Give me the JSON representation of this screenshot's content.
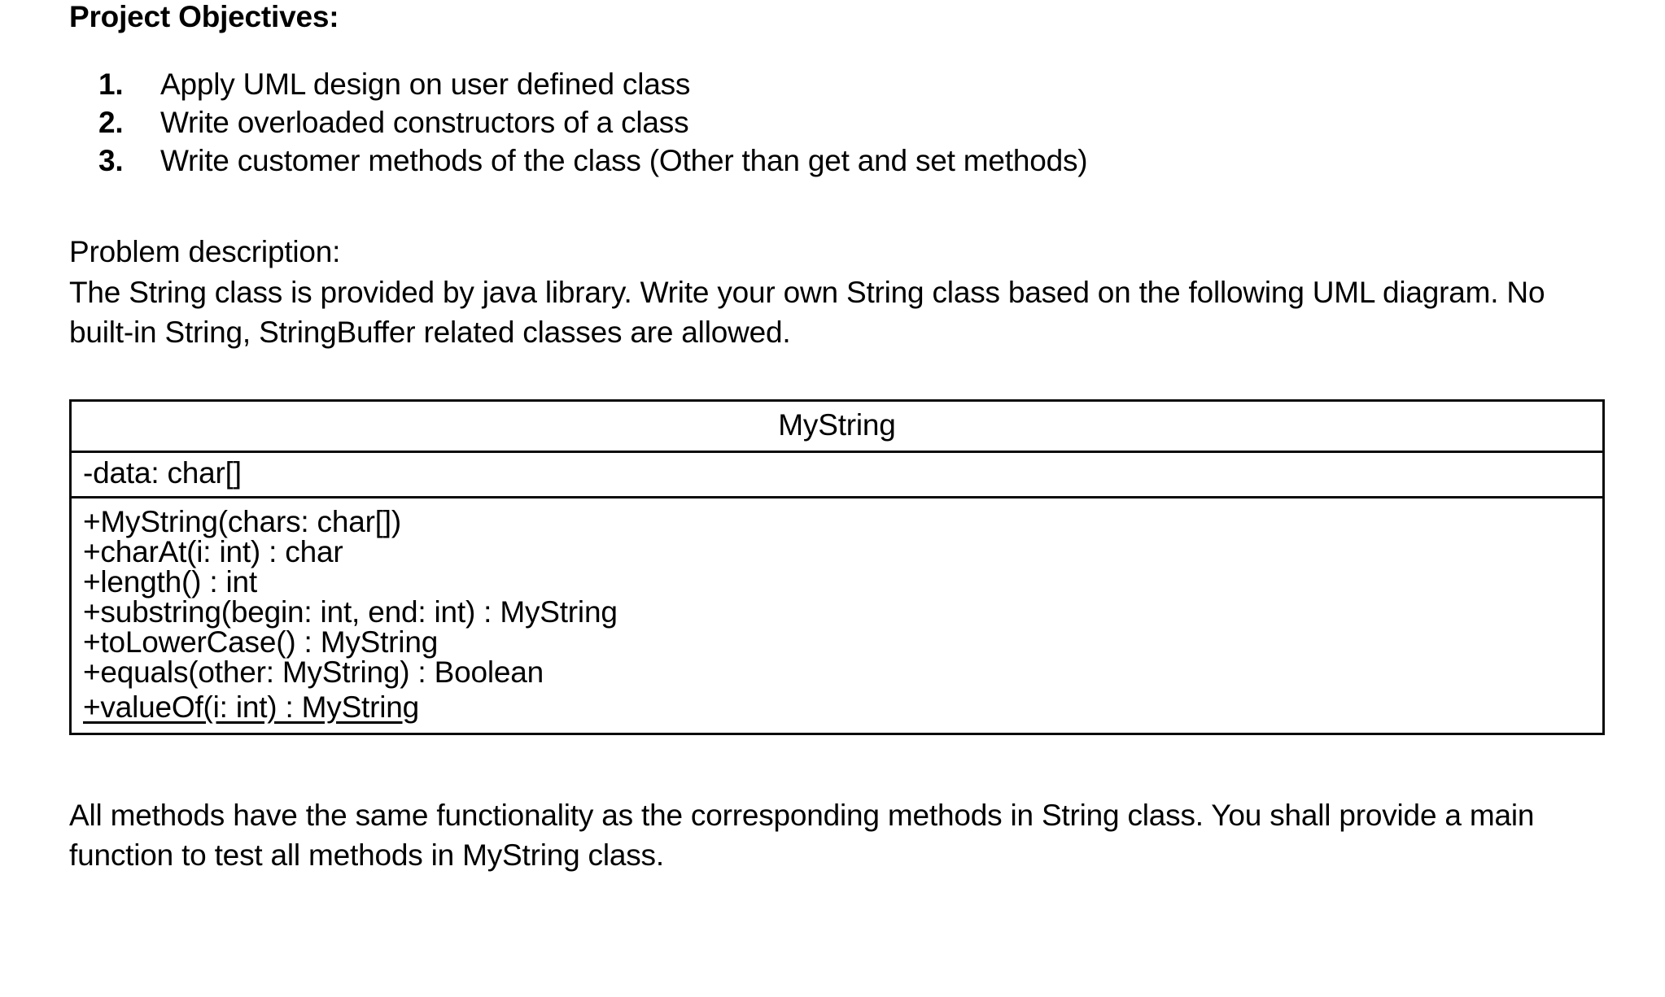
{
  "document": {
    "objectives_heading": "Project Objectives:",
    "objectives": [
      {
        "number": "1.",
        "text": "Apply UML design on user defined class"
      },
      {
        "number": "2.",
        "text": "Write overloaded constructors of a class"
      },
      {
        "number": "3.",
        "text": "Write customer methods of the class (Other than get and set methods)"
      }
    ],
    "problem_heading": "Problem description:",
    "problem_body": "The String class is provided by java library. Write your own String class based on the following UML diagram. No built-in String, StringBuffer related classes are allowed.",
    "uml": {
      "class_name": "MyString",
      "attributes": [
        "-data: char[]"
      ],
      "methods": [
        {
          "signature": "+MyString(chars: char[])",
          "static": false
        },
        {
          "signature": "+charAt(i: int) : char",
          "static": false
        },
        {
          "signature": "+length() : int",
          "static": false
        },
        {
          "signature": "+substring(begin: int, end: int) : MyString",
          "static": false
        },
        {
          "signature": "+toLowerCase() : MyString",
          "static": false
        },
        {
          "signature": "+equals(other: MyString) : Boolean",
          "static": false
        },
        {
          "signature": "+valueOf(i: int) : MyString",
          "static": true
        }
      ]
    },
    "closing_paragraph": "All methods have the same functionality as the corresponding methods in String class. You shall provide a main function to test all methods in MyString class.",
    "colors": {
      "text": "#000000",
      "background": "#ffffff",
      "table_border": "#0a0a0a"
    }
  }
}
